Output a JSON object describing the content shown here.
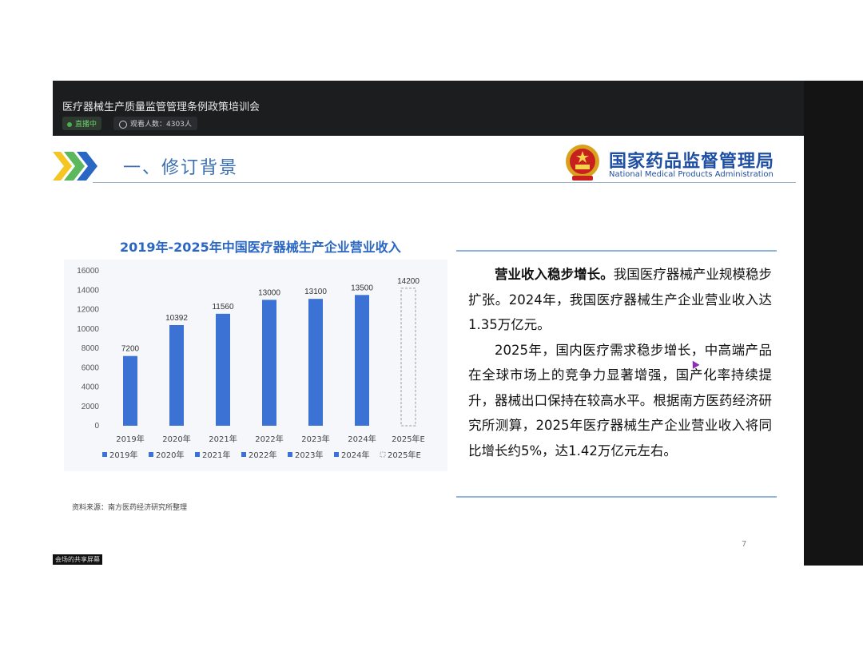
{
  "meeting": {
    "title": "医疗器械生产质量监管管理条例政策培训会",
    "live_label": "直播中",
    "viewers_label": "观看人数：4303人"
  },
  "slide": {
    "section_title": "一、修订背景",
    "agency_name": "国家药品监督管理局",
    "agency_en": "National Medical Products Administration",
    "source_note": "资料来源：南方医药经济研究所整理",
    "page_number": "7",
    "paragraph1_bold": "营业收入稳步增长。",
    "paragraph1_rest": "我国医疗器械产业规模稳步扩张。2024年，我国医疗器械生产企业营业收入达1.35万亿元。",
    "paragraph2": "2025年，国内医疗需求稳步增长，中高端产品在全球市场上的竞争力显著增强，国产化率持续提升，器械出口保持在较高水平。根据南方医药经济研究所测算，2025年医疗器械生产企业营业收入将同比增长约5%，达1.42万亿元左右。"
  },
  "share_label": "会场的共享屏幕",
  "colors": {
    "bar": "#3b72d4",
    "accent": "#2a66c4",
    "topbar": "#1b1d1f"
  },
  "chart_data": {
    "type": "bar",
    "title": "2019年-2025年中国医疗器械生产企业营业收入",
    "categories": [
      "2019年",
      "2020年",
      "2021年",
      "2022年",
      "2023年",
      "2024年",
      "2025年E"
    ],
    "values": [
      7200,
      10392,
      11560,
      13000,
      13100,
      13500,
      14200
    ],
    "value_labels": [
      "7200",
      "10392",
      "11560",
      "13000",
      "13100",
      "13500",
      "14200"
    ],
    "estimated": [
      false,
      false,
      false,
      false,
      false,
      false,
      true
    ],
    "legend": [
      "2019年",
      "2020年",
      "2021年",
      "2022年",
      "2023年",
      "2024年",
      "2025年E"
    ],
    "y_ticks": [
      "0",
      "2000",
      "4000",
      "6000",
      "8000",
      "10000",
      "12000",
      "14000",
      "16000"
    ],
    "ylim": [
      0,
      16000
    ],
    "legend_position": "bottom",
    "grid": false
  }
}
